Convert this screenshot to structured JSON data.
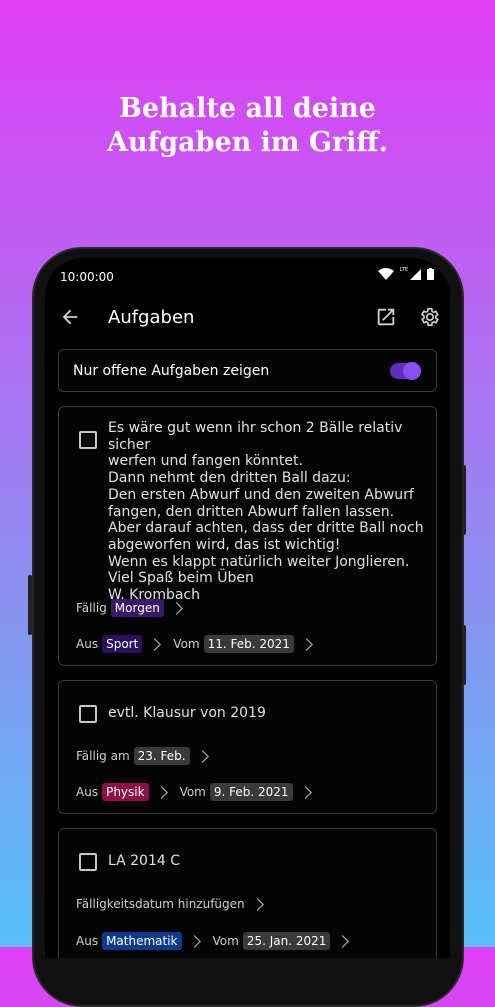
{
  "promo": {
    "line1": "Behalte all deine",
    "line2": "Aufgaben im Griff."
  },
  "status": {
    "time": "10:00:00",
    "lte": "LTE"
  },
  "appbar": {
    "title": "Aufgaben",
    "back_icon": "arrow-back-icon",
    "export_icon": "open-external-icon",
    "settings_icon": "gear-icon"
  },
  "filter": {
    "label": "Nur offene Aufgaben zeigen",
    "enabled": true
  },
  "tasks": [
    {
      "text": "Es wäre gut wenn ihr schon 2 Bälle relativ sicher\nwerfen und fangen könntet.\nDann nehmt den dritten Ball dazu:\nDen ersten Abwurf und den zweiten Abwurf\nfangen, den dritten Abwurf fallen lassen.\nAber darauf achten, dass der dritte Ball noch\nabgeworfen wird, das ist wichtig!\nWenn es klappt natürlich weiter Jonglieren.\nViel Spaß beim Üben\nW. Krombach",
      "due_label": "Fällig",
      "due_value": "Morgen",
      "due_color": "#3a1a66",
      "from_label": "Aus",
      "subject": "Sport",
      "subject_color": "#2c1060",
      "since_label": "Vom",
      "date": "11. Feb. 2021"
    },
    {
      "text": "evtl. Klausur von 2019",
      "due_label": "Fällig am",
      "due_value": "23. Feb.",
      "due_color": "#3a3a3a",
      "from_label": "Aus",
      "subject": "Physik",
      "subject_color": "#8a1045",
      "since_label": "Vom",
      "date": "9. Feb. 2021"
    },
    {
      "text": "LA 2014 C",
      "due_label": "Fälligkeitsdatum hinzufügen",
      "due_value": "",
      "from_label": "Aus",
      "subject": "Mathematik",
      "subject_color": "#0d3a8a",
      "since_label": "Vom",
      "date": "25. Jan. 2021"
    }
  ],
  "colors": {
    "date_chip": "#3a3a3a",
    "accent": "#8b4cf5"
  }
}
